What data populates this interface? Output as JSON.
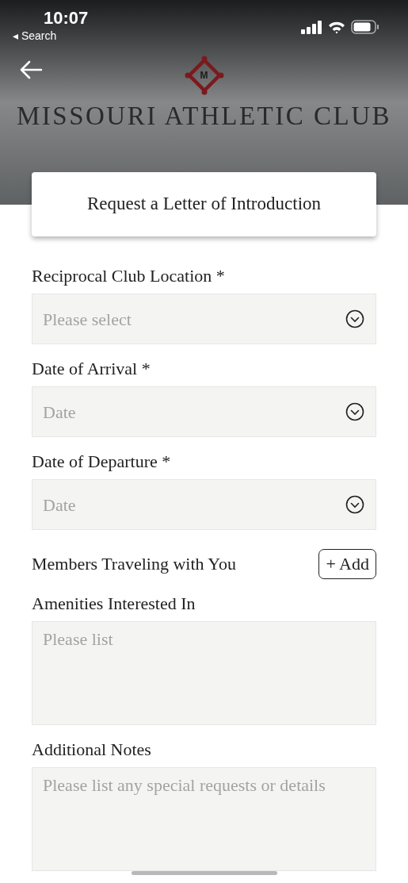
{
  "status_bar": {
    "time": "10:07",
    "back_label": "◂ Search"
  },
  "header": {
    "logo_letter": "M",
    "club_name": "MISSOURI ATHLETIC CLUB"
  },
  "card": {
    "title": "Request a Letter of Introduction"
  },
  "fields": [
    {
      "kind": "select",
      "label": "Reciprocal Club Location *",
      "placeholder": "Please select"
    },
    {
      "kind": "select",
      "label": "Date of Arrival *",
      "placeholder": "Date"
    },
    {
      "kind": "select",
      "label": "Date of Departure *",
      "placeholder": "Date"
    },
    {
      "kind": "add",
      "label": "Members Traveling with You",
      "button": "+ Add"
    },
    {
      "kind": "textarea",
      "label": "Amenities Interested In",
      "placeholder": "Please list"
    },
    {
      "kind": "textarea",
      "label": "Additional Notes",
      "placeholder": "Please list any special requests or details"
    }
  ]
}
